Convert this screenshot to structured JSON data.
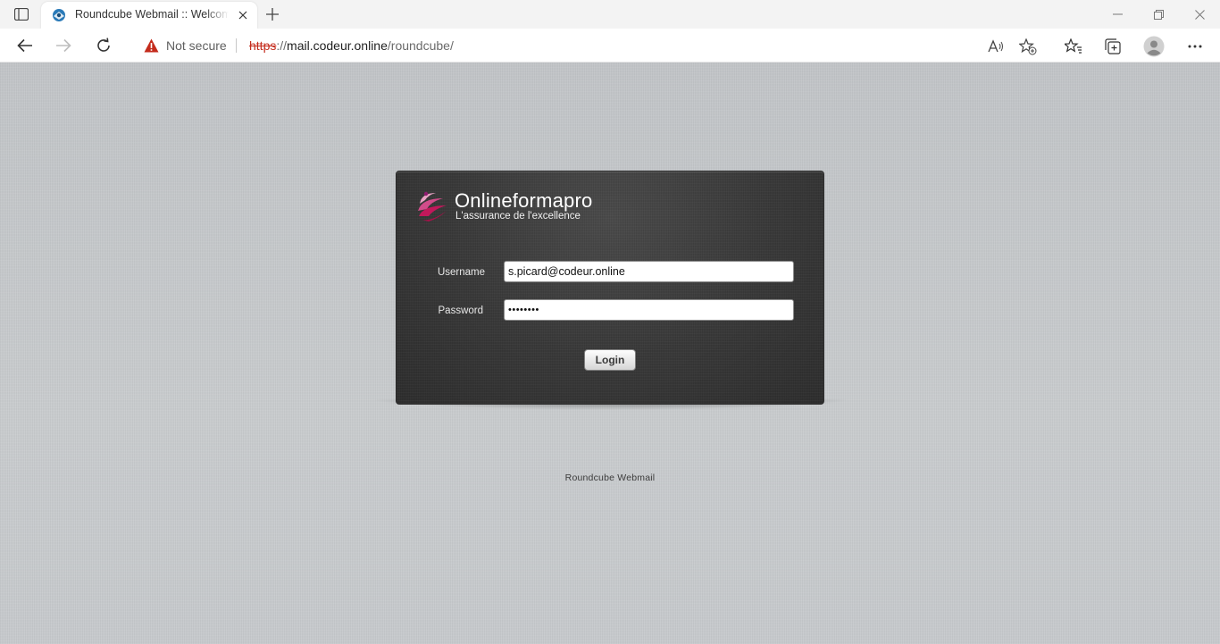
{
  "browser": {
    "tab": {
      "title": "Roundcube Webmail :: Welcome to Roundcube Webmail"
    },
    "address": {
      "security_label": "Not secure",
      "url_scheme": "https",
      "url_sep": "://",
      "url_host": "mail.codeur.online",
      "url_path": "/roundcube/"
    }
  },
  "login": {
    "brand_name": "Onlineformapro",
    "brand_tagline": "L'assurance de l'excellence",
    "username_label": "Username",
    "username_value": "s.picard@codeur.online",
    "password_label": "Password",
    "password_value": "password",
    "login_button": "Login"
  },
  "footer": {
    "text": "Roundcube Webmail"
  },
  "colors": {
    "page_background": "#c6c9cc",
    "login_panel": "#3a3a3a",
    "brand_accent": "#c2185b",
    "insecure_red": "#c42b1c"
  }
}
